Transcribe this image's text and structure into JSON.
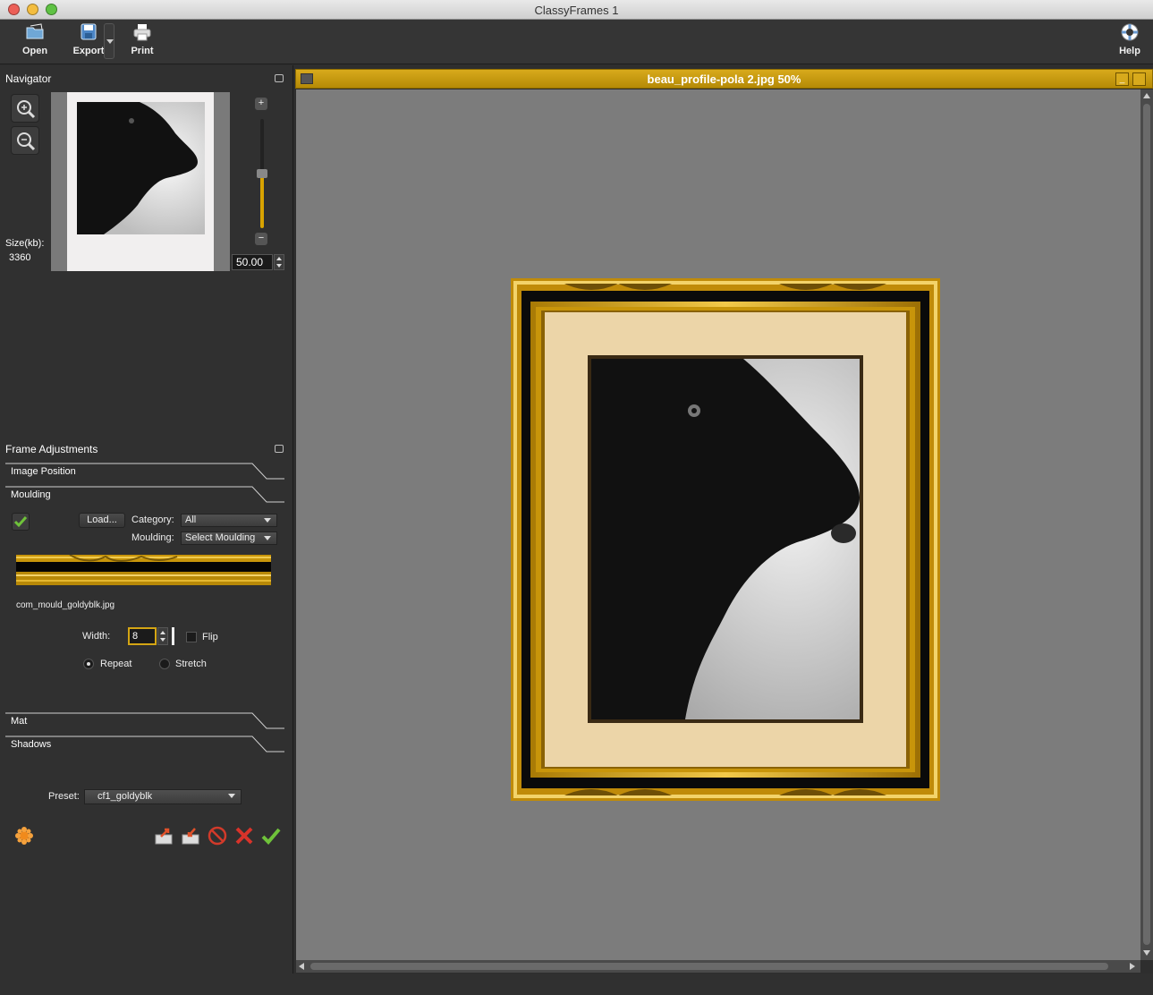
{
  "window": {
    "title": "ClassyFrames 1"
  },
  "toolbar": {
    "open": "Open",
    "export": "Export",
    "print": "Print",
    "help": "Help"
  },
  "navigator": {
    "title": "Navigator",
    "size_label": "Size(kb):",
    "size_value": "3360",
    "zoom_value": "50.00",
    "zoom_level": 0.5
  },
  "frame_adjustments": {
    "title": "Frame Adjustments",
    "sections": {
      "image_position": "Image Position",
      "moulding": "Moulding",
      "mat": "Mat",
      "shadows": "Shadows"
    },
    "moulding": {
      "load_label": "Load...",
      "category_label": "Category:",
      "category_value": "All",
      "moulding_label": "Moulding:",
      "moulding_value": "Select Moulding",
      "filename": "com_mould_goldyblk.jpg",
      "width_label": "Width:",
      "width_value": "8",
      "flip_label": "Flip",
      "repeat_label": "Repeat",
      "stretch_label": "Stretch"
    },
    "preset_label": "Preset:",
    "preset_value": "cf1_goldyblk"
  },
  "document": {
    "title": "beau_profile-pola 2.jpg 50%"
  },
  "colors": {
    "accent": "#d4a514",
    "gold": "#c8950a",
    "mat": "#ecd5a8",
    "canvas": "#7c7c7c"
  }
}
